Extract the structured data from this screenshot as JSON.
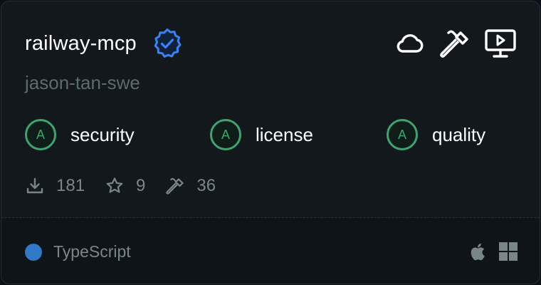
{
  "server": {
    "name": "railway-mcp",
    "author": "jason-tan-swe",
    "verified": true
  },
  "capabilities": [
    "cloud-icon",
    "hammer-icon",
    "monitor-play-icon"
  ],
  "grades": [
    {
      "letter": "A",
      "label": "security"
    },
    {
      "letter": "A",
      "label": "license"
    },
    {
      "letter": "A",
      "label": "quality"
    }
  ],
  "stats": {
    "downloads": "181",
    "stars": "9",
    "tools": "36"
  },
  "footer": {
    "language": "TypeScript",
    "language_color": "#3178c6",
    "platforms": [
      "apple-icon",
      "windows-icon"
    ]
  },
  "colors": {
    "accent_verified": "#3b82f6",
    "grade_green": "#3ea370"
  }
}
